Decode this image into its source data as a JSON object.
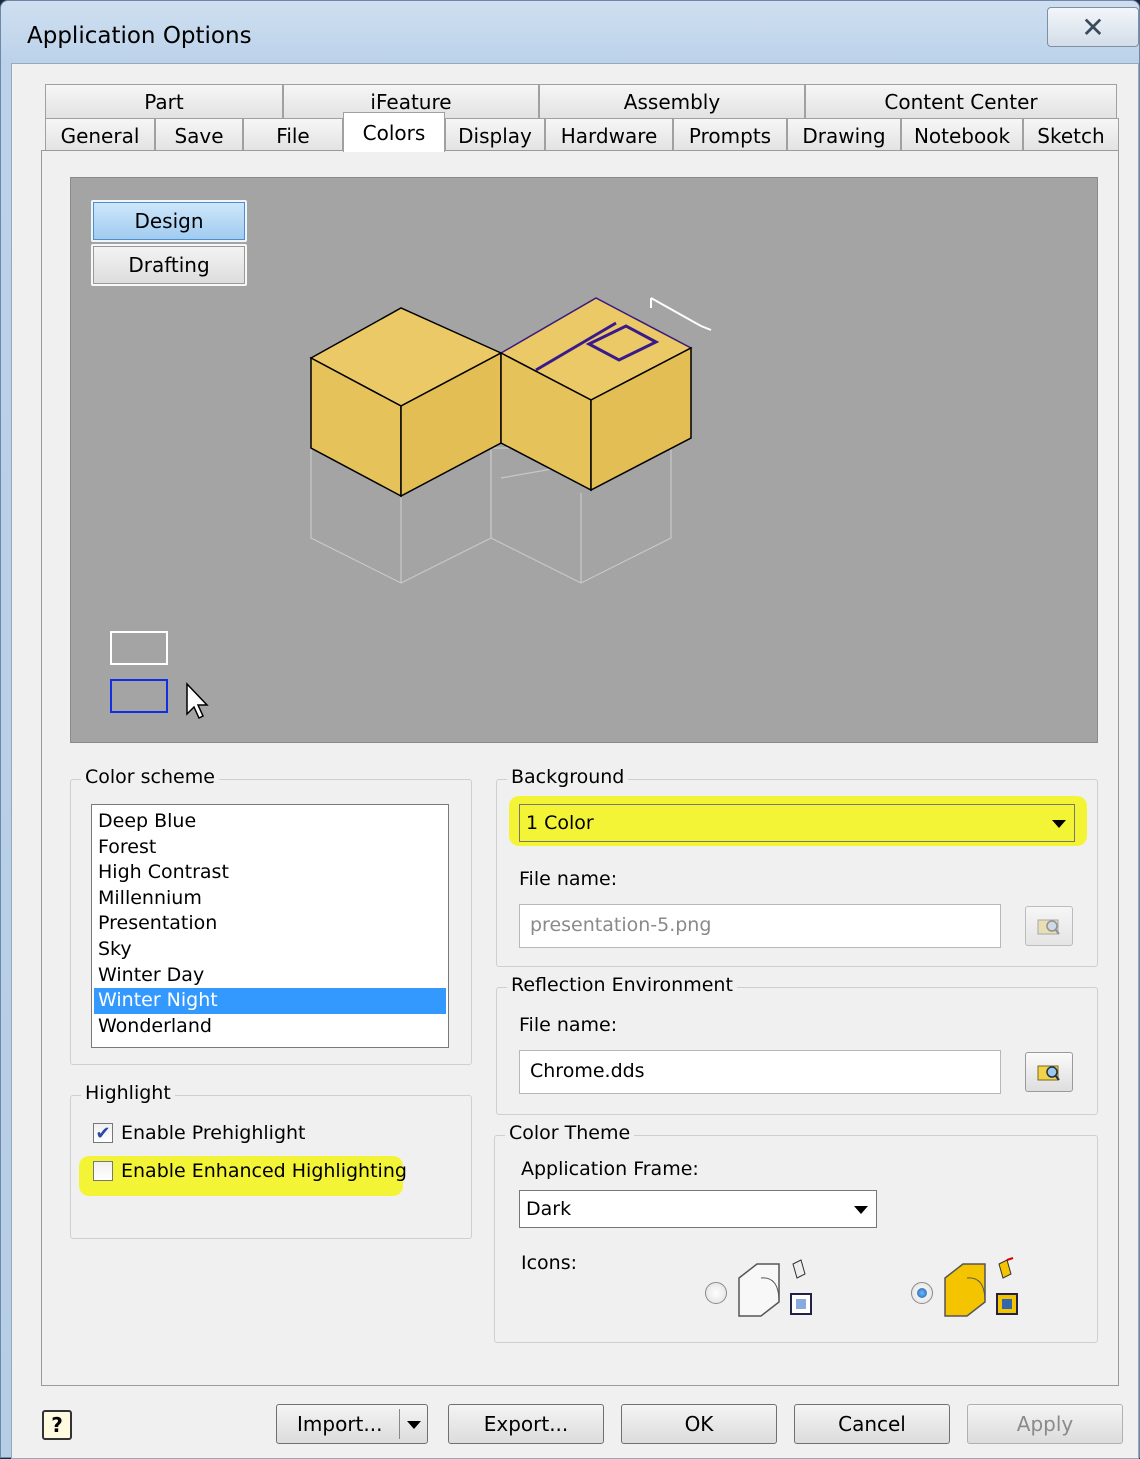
{
  "window": {
    "title": "Application Options",
    "close_glyph": "✕"
  },
  "tabs_row1": [
    "Part",
    "iFeature",
    "Assembly",
    "Content Center"
  ],
  "tabs_row2": [
    "General",
    "Save",
    "File",
    "Colors",
    "Display",
    "Hardware",
    "Prompts",
    "Drawing",
    "Notebook",
    "Sketch"
  ],
  "active_tab": "Colors",
  "preview": {
    "design_label": "Design",
    "drafting_label": "Drafting",
    "active_mode": "Design",
    "background_color": "#a4a4a4",
    "part_color": "#e6c35a"
  },
  "color_scheme": {
    "label": "Color scheme",
    "items": [
      "Deep Blue",
      "Forest",
      "High Contrast",
      "Millennium",
      "Presentation",
      "Sky",
      "Winter Day",
      "Winter Night",
      "Wonderland"
    ],
    "selected": "Winter Night"
  },
  "background": {
    "label": "Background",
    "value": "1 Color",
    "file_label": "File name:",
    "file_value": "presentation-5.png"
  },
  "reflection": {
    "label": "Reflection Environment",
    "file_label": "File name:",
    "file_value": "Chrome.dds"
  },
  "highlight": {
    "label": "Highlight",
    "prehighlight_label": "Enable Prehighlight",
    "prehighlight_checked": true,
    "enhanced_label": "Enable Enhanced Highlighting",
    "enhanced_checked": false
  },
  "color_theme": {
    "label": "Color Theme",
    "frame_label": "Application Frame:",
    "frame_value": "Dark",
    "icons_label": "Icons:",
    "selected_icon_set": "yellow"
  },
  "buttons": {
    "import": "Import...",
    "export": "Export...",
    "ok": "OK",
    "cancel": "Cancel",
    "apply": "Apply"
  },
  "highlight_color": "#f4f416",
  "selection_color": "#3399ff"
}
